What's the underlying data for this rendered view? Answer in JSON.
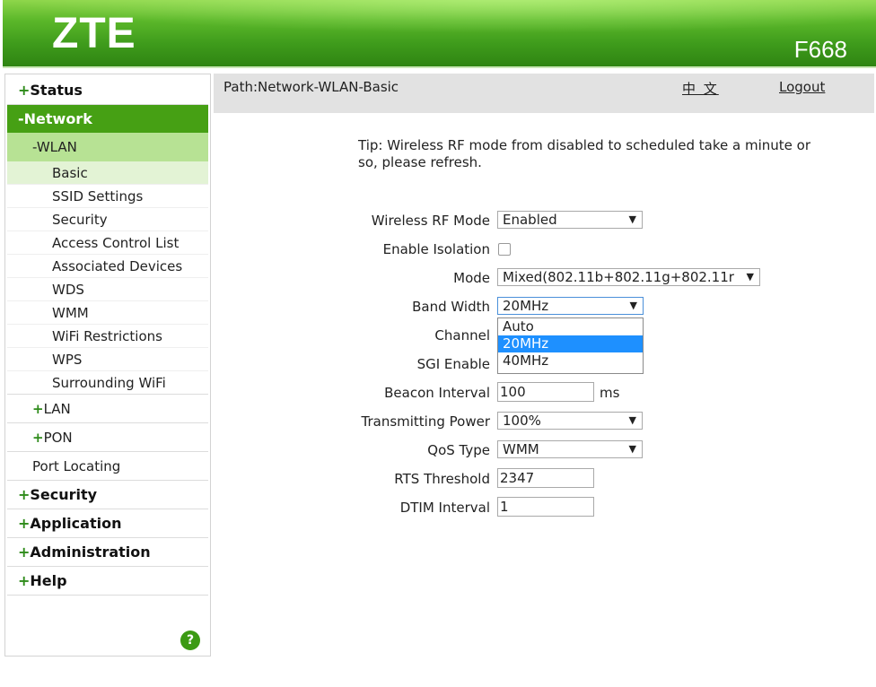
{
  "header": {
    "logo": "ZTE",
    "model": "F668"
  },
  "topbar": {
    "path": "Path:Network-WLAN-Basic",
    "language": "中 文",
    "logout": "Logout"
  },
  "sidebar": {
    "items": [
      {
        "label": "Status",
        "prefix": "+"
      },
      {
        "label": "Network",
        "prefix": "-"
      },
      {
        "label": "WLAN",
        "prefix": "-"
      },
      {
        "label": "Basic"
      },
      {
        "label": "SSID Settings"
      },
      {
        "label": "Security"
      },
      {
        "label": "Access Control List"
      },
      {
        "label": "Associated Devices"
      },
      {
        "label": "WDS"
      },
      {
        "label": "WMM"
      },
      {
        "label": "WiFi Restrictions"
      },
      {
        "label": "WPS"
      },
      {
        "label": "Surrounding WiFi"
      },
      {
        "label": "LAN",
        "prefix": "+"
      },
      {
        "label": "PON",
        "prefix": "+"
      },
      {
        "label": "Port Locating"
      },
      {
        "label": "Security",
        "prefix": "+"
      },
      {
        "label": "Application",
        "prefix": "+"
      },
      {
        "label": "Administration",
        "prefix": "+"
      },
      {
        "label": "Help",
        "prefix": "+"
      }
    ],
    "help_icon": "?"
  },
  "main": {
    "tip": "Tip: Wireless RF mode from disabled to scheduled take a minute or so, please refresh.",
    "fields": {
      "rf_mode": {
        "label": "Wireless RF Mode",
        "value": "Enabled"
      },
      "isolation": {
        "label": "Enable Isolation",
        "checked": false
      },
      "mode": {
        "label": "Mode",
        "value": "Mixed(802.11b+802.11g+802.11r"
      },
      "bandwidth": {
        "label": "Band Width",
        "value": "20MHz",
        "options": [
          "Auto",
          "20MHz",
          "40MHz"
        ]
      },
      "channel": {
        "label": "Channel"
      },
      "sgi": {
        "label": "SGI Enable"
      },
      "beacon": {
        "label": "Beacon Interval",
        "value": "100",
        "unit": "ms"
      },
      "tx_power": {
        "label": "Transmitting Power",
        "value": "100%"
      },
      "qos": {
        "label": "QoS Type",
        "value": "WMM"
      },
      "rts": {
        "label": "RTS Threshold",
        "value": "2347"
      },
      "dtim": {
        "label": "DTIM Interval",
        "value": "1"
      }
    }
  },
  "icons": {
    "dropdown_arrow": "▼"
  },
  "colors": {
    "nav_active": "#46a014",
    "subnav_active": "#b7e294",
    "highlight": "#1e90ff"
  }
}
